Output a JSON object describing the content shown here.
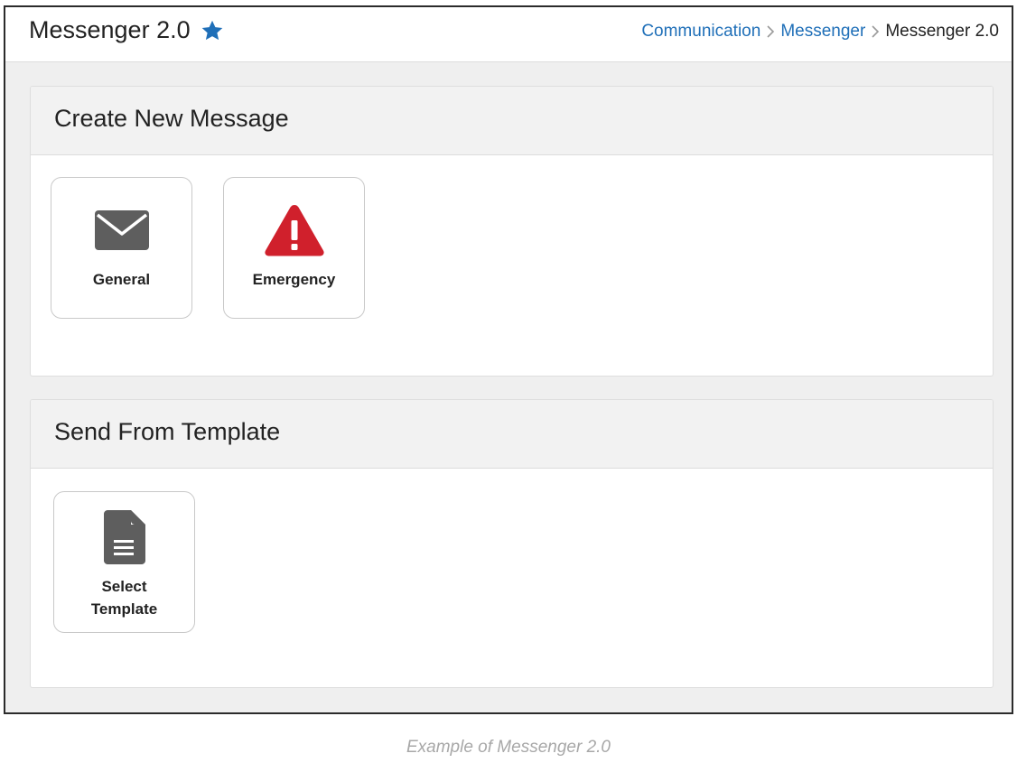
{
  "header": {
    "title": "Messenger 2.0",
    "favorite_icon": "star-icon",
    "breadcrumb": {
      "items": [
        "Communication",
        "Messenger",
        "Messenger 2.0"
      ],
      "separator_icon": "chevron-right-icon"
    }
  },
  "create_panel": {
    "title": "Create New Message",
    "tiles": [
      {
        "label": "General",
        "icon": "envelope-icon"
      },
      {
        "label": "Emergency",
        "icon": "warning-icon"
      }
    ]
  },
  "template_panel": {
    "title": "Send From Template",
    "tiles": [
      {
        "label_line1": "Select",
        "label_line2": "Template",
        "icon": "document-icon"
      }
    ]
  },
  "caption": "Example of Messenger 2.0",
  "colors": {
    "link": "#1f6fb8",
    "star": "#1f6fb8",
    "emergency": "#d0202c",
    "icon_gray": "#5e5e5e"
  }
}
